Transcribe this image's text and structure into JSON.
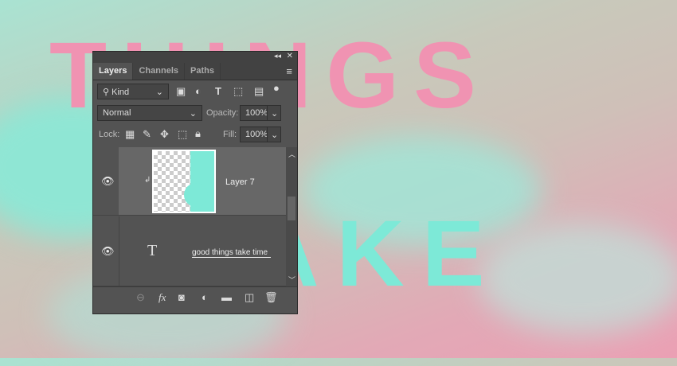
{
  "canvas": {
    "word_top": "THINGS",
    "word_bottom": "TAKE",
    "pink": "#f093b2",
    "mint": "#7de9d7"
  },
  "panel": {
    "tabs": [
      {
        "label": "Layers"
      },
      {
        "label": "Channels"
      },
      {
        "label": "Paths"
      }
    ],
    "filter": {
      "label": "Kind"
    },
    "blend_mode": "Normal",
    "opacity_label": "Opacity:",
    "opacity_value": "100%",
    "lock_label": "Lock:",
    "fill_label": "Fill:",
    "fill_value": "100%",
    "layers": [
      {
        "name": "Layer 7",
        "clipped": true
      },
      {
        "name": "good things take time",
        "type": "text",
        "glyph": "T"
      }
    ],
    "footer_icons": [
      "link-icon",
      "fx-icon",
      "mask-icon",
      "adjustment-icon",
      "folder-icon",
      "new-layer-icon",
      "trash-icon"
    ],
    "fx_label": "fx"
  }
}
